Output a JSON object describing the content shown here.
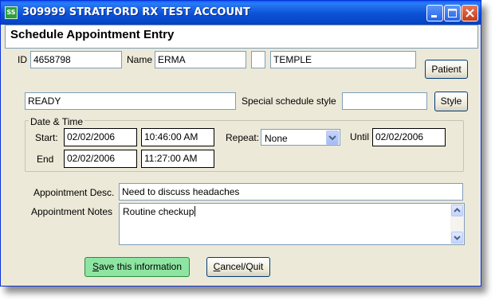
{
  "window": {
    "title": "309999 STRATFORD RX TEST ACCOUNT",
    "icon_label": "SS",
    "icon": "app-icon",
    "controls": [
      "minimize-icon",
      "maximize-icon",
      "close-icon"
    ]
  },
  "header": {
    "title": "Schedule Appointment Entry"
  },
  "patient": {
    "id_label": "ID",
    "id_value": "4658798",
    "name_label": "Name",
    "first_name": "ERMA",
    "middle_initial": "",
    "last_name": "TEMPLE",
    "patient_button": "Patient"
  },
  "status": {
    "value": "READY",
    "style_label": "Special schedule style",
    "style_value": "",
    "style_button": "Style"
  },
  "datetime": {
    "group_label": "Date & Time",
    "start_label": "Start:",
    "start_date": "02/02/2006",
    "start_time": "10:46:00 AM",
    "end_label": "End",
    "end_date": "02/02/2006",
    "end_time": "11:27:00 AM",
    "repeat_label": "Repeat:",
    "repeat_value": "None",
    "until_label": "Until",
    "until_date": "02/02/2006"
  },
  "appointment": {
    "desc_label": "Appointment Desc.",
    "desc_value": "Need to discuss headaches",
    "notes_label": "Appointment Notes",
    "notes_value": "Routine checkup"
  },
  "actions": {
    "save_underline": "S",
    "save_rest": "ave this information",
    "cancel_underline": "C",
    "cancel_rest": "ancel/Quit"
  },
  "colors": {
    "titlebar": "#0a5ef7",
    "dialog_bg": "#ece9d8",
    "save_button": "#8ee5a2"
  }
}
